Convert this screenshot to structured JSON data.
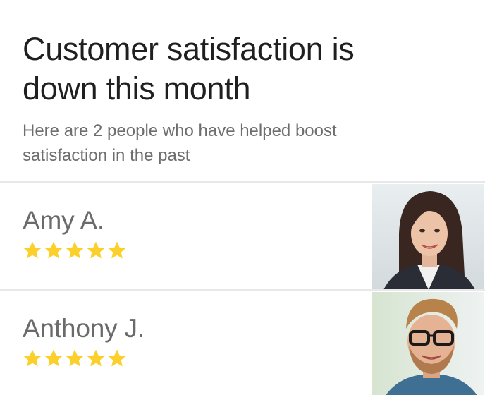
{
  "header": {
    "title_line1": "Customer satisfaction is",
    "title_line2": "down this month",
    "subtitle_line1": "Here are 2 people who have helped boost",
    "subtitle_line2": "satisfaction in the past"
  },
  "people": [
    {
      "name": "Amy A.",
      "rating": 5,
      "max_rating": 5
    },
    {
      "name": "Anthony J.",
      "rating": 5,
      "max_rating": 5
    }
  ],
  "colors": {
    "star": "#fcd02a",
    "title_text": "#1f1f1f",
    "secondary_text": "#6e6e6e",
    "divider": "#e8e8e8"
  },
  "icons": {
    "rating": "star-icon"
  }
}
